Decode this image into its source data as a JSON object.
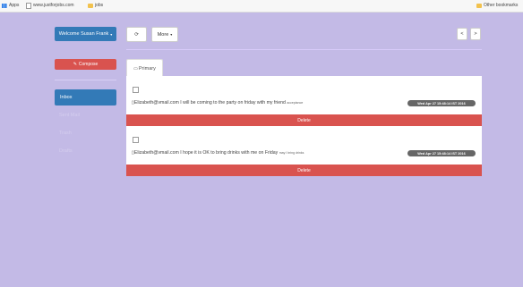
{
  "bookmarks": {
    "apps": "Apps",
    "site": "www.justforjobs.com",
    "folder": "jobs",
    "other": "Other bookmarks"
  },
  "header": {
    "welcome_label": "Welcome Susan Frank",
    "refresh_glyph": "⟳",
    "more_label": "More",
    "prev_glyph": "<",
    "next_glyph": ">"
  },
  "sidebar": {
    "compose_label": "Compose",
    "items": [
      {
        "label": "Inbox",
        "active": true
      },
      {
        "label": "Sent Mail",
        "active": false
      },
      {
        "label": "Trash",
        "active": false
      },
      {
        "label": "Drafts",
        "active": false
      }
    ]
  },
  "tabs": [
    {
      "label": "Primary"
    }
  ],
  "messages": [
    {
      "from": "Elizabeth@vmail.com",
      "text": "I will be coming to the party on friday with my friend",
      "tag": "acceptance",
      "date": "Wed Apr 27 15:48:14 IST 2016",
      "delete_label": "Delete"
    },
    {
      "from": "Elizabeth@vmail.com",
      "text": "I hope it is OK to bring drinks with me on Friday",
      "tag": "may I bring drinks",
      "date": "Wed Apr 27 15:48:14 IST 2016",
      "delete_label": "Delete"
    }
  ],
  "colors": {
    "background": "#c3bae6",
    "primary": "#337ab7",
    "danger": "#d9534f",
    "badge": "#666666"
  }
}
